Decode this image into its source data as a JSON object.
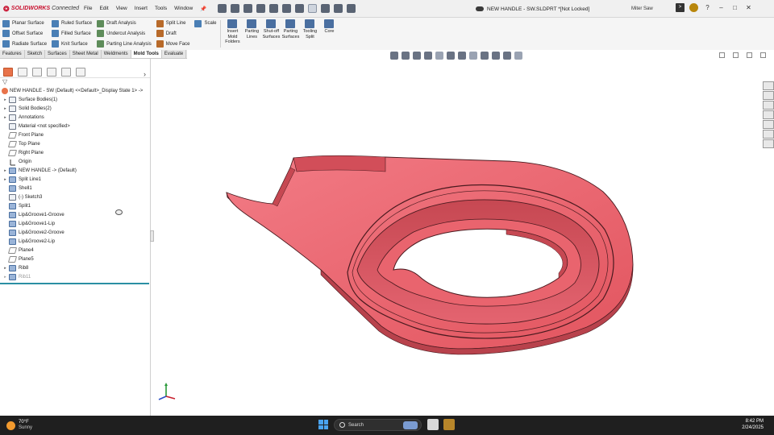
{
  "app": {
    "logo": "SOLIDWORKS",
    "logo_suffix": "Connected",
    "document_title": "NEW HANDLE - SW.SLDPRT *[Not Locked]",
    "search_label": "Miter Saw"
  },
  "menu": [
    "File",
    "Edit",
    "View",
    "Insert",
    "Tools",
    "Window"
  ],
  "ribbon": {
    "col1": [
      "Planar Surface",
      "Offset Surface",
      "Radiate Surface"
    ],
    "col2": [
      "Ruled Surface",
      "Filled Surface",
      "Knit Surface"
    ],
    "col3": [
      "Draft Analysis",
      "Undercut Analysis",
      "Parting Line Analysis"
    ],
    "col4": [
      "Split Line",
      "Draft",
      "Move Face"
    ],
    "col5": [
      "Scale"
    ],
    "big": [
      "Insert Mold Folders",
      "Parting Lines",
      "Shut-off Surfaces",
      "Parting Surfaces",
      "Tooling Split",
      "Core"
    ]
  },
  "tabs": [
    "Features",
    "Sketch",
    "Surfaces",
    "Sheet Metal",
    "Weldments",
    "Mold Tools",
    "Evaluate"
  ],
  "active_tab": "Mold Tools",
  "tree": {
    "root": "NEW HANDLE - SW (Default) <<Default>_Display State 1> ->",
    "items": [
      {
        "label": "Surface Bodies(1)",
        "icon": "folder-icon",
        "expand": true
      },
      {
        "label": "Solid Bodies(2)",
        "icon": "folder-icon",
        "expand": true
      },
      {
        "label": "Annotations",
        "icon": "annotation-icon",
        "expand": true
      },
      {
        "label": "Material <not specified>",
        "icon": "material-icon",
        "expand": false
      },
      {
        "label": "Front Plane",
        "icon": "plane-icon",
        "expand": false
      },
      {
        "label": "Top Plane",
        "icon": "plane-icon",
        "expand": false
      },
      {
        "label": "Right Plane",
        "icon": "plane-icon",
        "expand": false
      },
      {
        "label": "Origin",
        "icon": "origin-icon",
        "expand": false
      },
      {
        "label": "NEW HANDLE -> (Default)",
        "icon": "part-icon",
        "expand": true
      },
      {
        "label": "Split Line1",
        "icon": "split-line-icon",
        "expand": true
      },
      {
        "label": "Shell1",
        "icon": "shell-icon",
        "expand": false
      },
      {
        "label": "(-) Sketch3",
        "icon": "sketch-icon",
        "expand": false
      },
      {
        "label": "Split1",
        "icon": "split-icon",
        "expand": false
      },
      {
        "label": "Lip&Groove1-Groove",
        "icon": "lip-groove-icon",
        "expand": false
      },
      {
        "label": "Lip&Groove1-Lip",
        "icon": "lip-groove-icon",
        "expand": false
      },
      {
        "label": "Lip&Groove2-Groove",
        "icon": "lip-groove-icon",
        "expand": false
      },
      {
        "label": "Lip&Groove2-Lip",
        "icon": "lip-groove-icon",
        "expand": false
      },
      {
        "label": "Plane4",
        "icon": "plane-icon",
        "expand": false
      },
      {
        "label": "Plane5",
        "icon": "plane-icon",
        "expand": false
      },
      {
        "label": "Rib8",
        "icon": "rib-icon",
        "expand": true
      },
      {
        "label": "Rib11",
        "icon": "rib-icon",
        "expand": true,
        "suppressed": true
      }
    ]
  },
  "taskbar": {
    "temperature": "70°F",
    "weather": "Sunny",
    "search": "Search",
    "time": "8:42 PM",
    "date": "2/24/2025"
  },
  "colors": {
    "model": "#e9646e",
    "model_dark": "#b8424c",
    "model_edge": "#4a1a1f",
    "accent": "#c8102e",
    "rollback_bar": "#2b8fa3"
  }
}
